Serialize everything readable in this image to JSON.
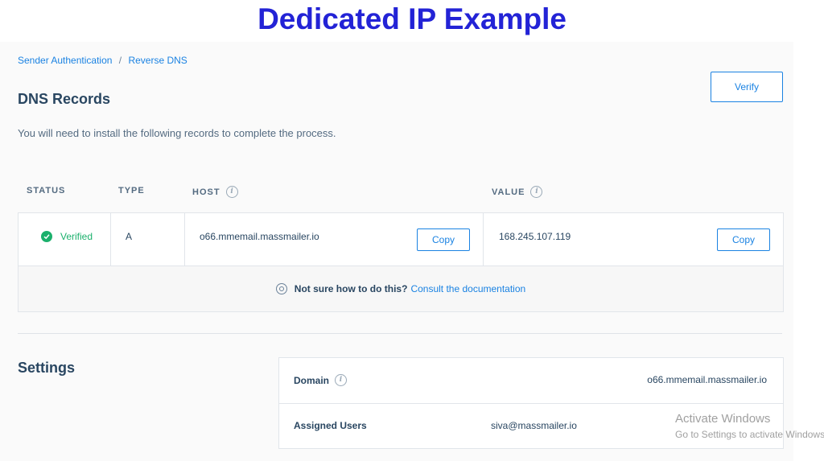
{
  "banner": {
    "title": "Dedicated IP Example"
  },
  "breadcrumb": {
    "items": [
      "Sender Authentication",
      "Reverse DNS"
    ],
    "separator": "/"
  },
  "page": {
    "title": "DNS Records",
    "verify_label": "Verify",
    "intro": "You will need to install the following records to complete the process."
  },
  "table": {
    "headers": {
      "status": "STATUS",
      "type": "TYPE",
      "host": "HOST",
      "value": "VALUE"
    },
    "rows": [
      {
        "status": "Verified",
        "type": "A",
        "host": "o66.mmemail.massmailer.io",
        "value": "168.245.107.119"
      }
    ],
    "copy_label": "Copy",
    "help_question": "Not sure how to do this?",
    "help_link": "Consult the documentation"
  },
  "settings": {
    "title": "Settings",
    "domain_label": "Domain",
    "domain_value": "o66.mmemail.massmailer.io",
    "users_label": "Assigned Users",
    "users_value": "siva@massmailer.io"
  },
  "watermark": {
    "title": "Activate Windows",
    "subtitle": "Go to Settings to activate Windows."
  },
  "colors": {
    "accent": "#1a82e2",
    "success": "#1bb06c",
    "banner": "#2323d6",
    "text": "#294661"
  },
  "icons": {
    "status": "check-circle-icon",
    "info": "info-icon",
    "help": "lifebuoy-icon"
  }
}
